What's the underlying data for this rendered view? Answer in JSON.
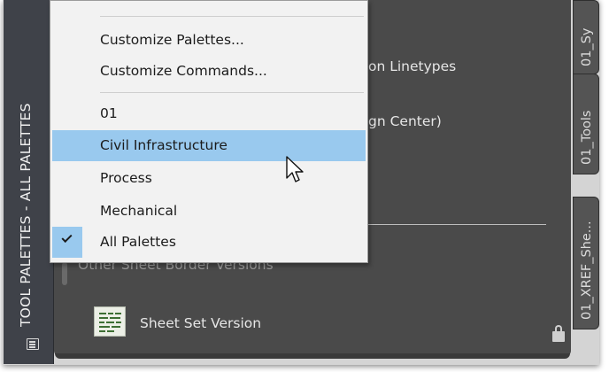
{
  "window": {
    "title": "TOOL PALETTES - ALL PALETTES"
  },
  "background_items": {
    "linetypes_partial": "on Linetypes",
    "design_center_partial": "gn Center)",
    "other_sheet_border": "Other Sheet Border Versions",
    "sheet_set_version": "Sheet Set Version"
  },
  "side_tabs": [
    {
      "label": "01_Sy"
    },
    {
      "label": "01_Tools"
    },
    {
      "label": "01_XREF_She..."
    }
  ],
  "context_menu": {
    "items": [
      {
        "label": "Customize Palettes..."
      },
      {
        "label": "Customize Commands..."
      },
      {
        "label": "01"
      },
      {
        "label": "Civil Infrastructure",
        "highlighted": true
      },
      {
        "label": "Process"
      },
      {
        "label": "Mechanical"
      },
      {
        "label": "All Palettes",
        "checked": true
      }
    ]
  },
  "icons": [
    "palettes-icon",
    "sheet-set-icon",
    "lock-icon",
    "check-icon",
    "mouse-pointer-icon"
  ],
  "colors": {
    "menu_bg": "#f2f2f2",
    "highlight": "#99c9ee",
    "palette_bg": "#4a4a4a",
    "title_strip": "#3f4249"
  }
}
